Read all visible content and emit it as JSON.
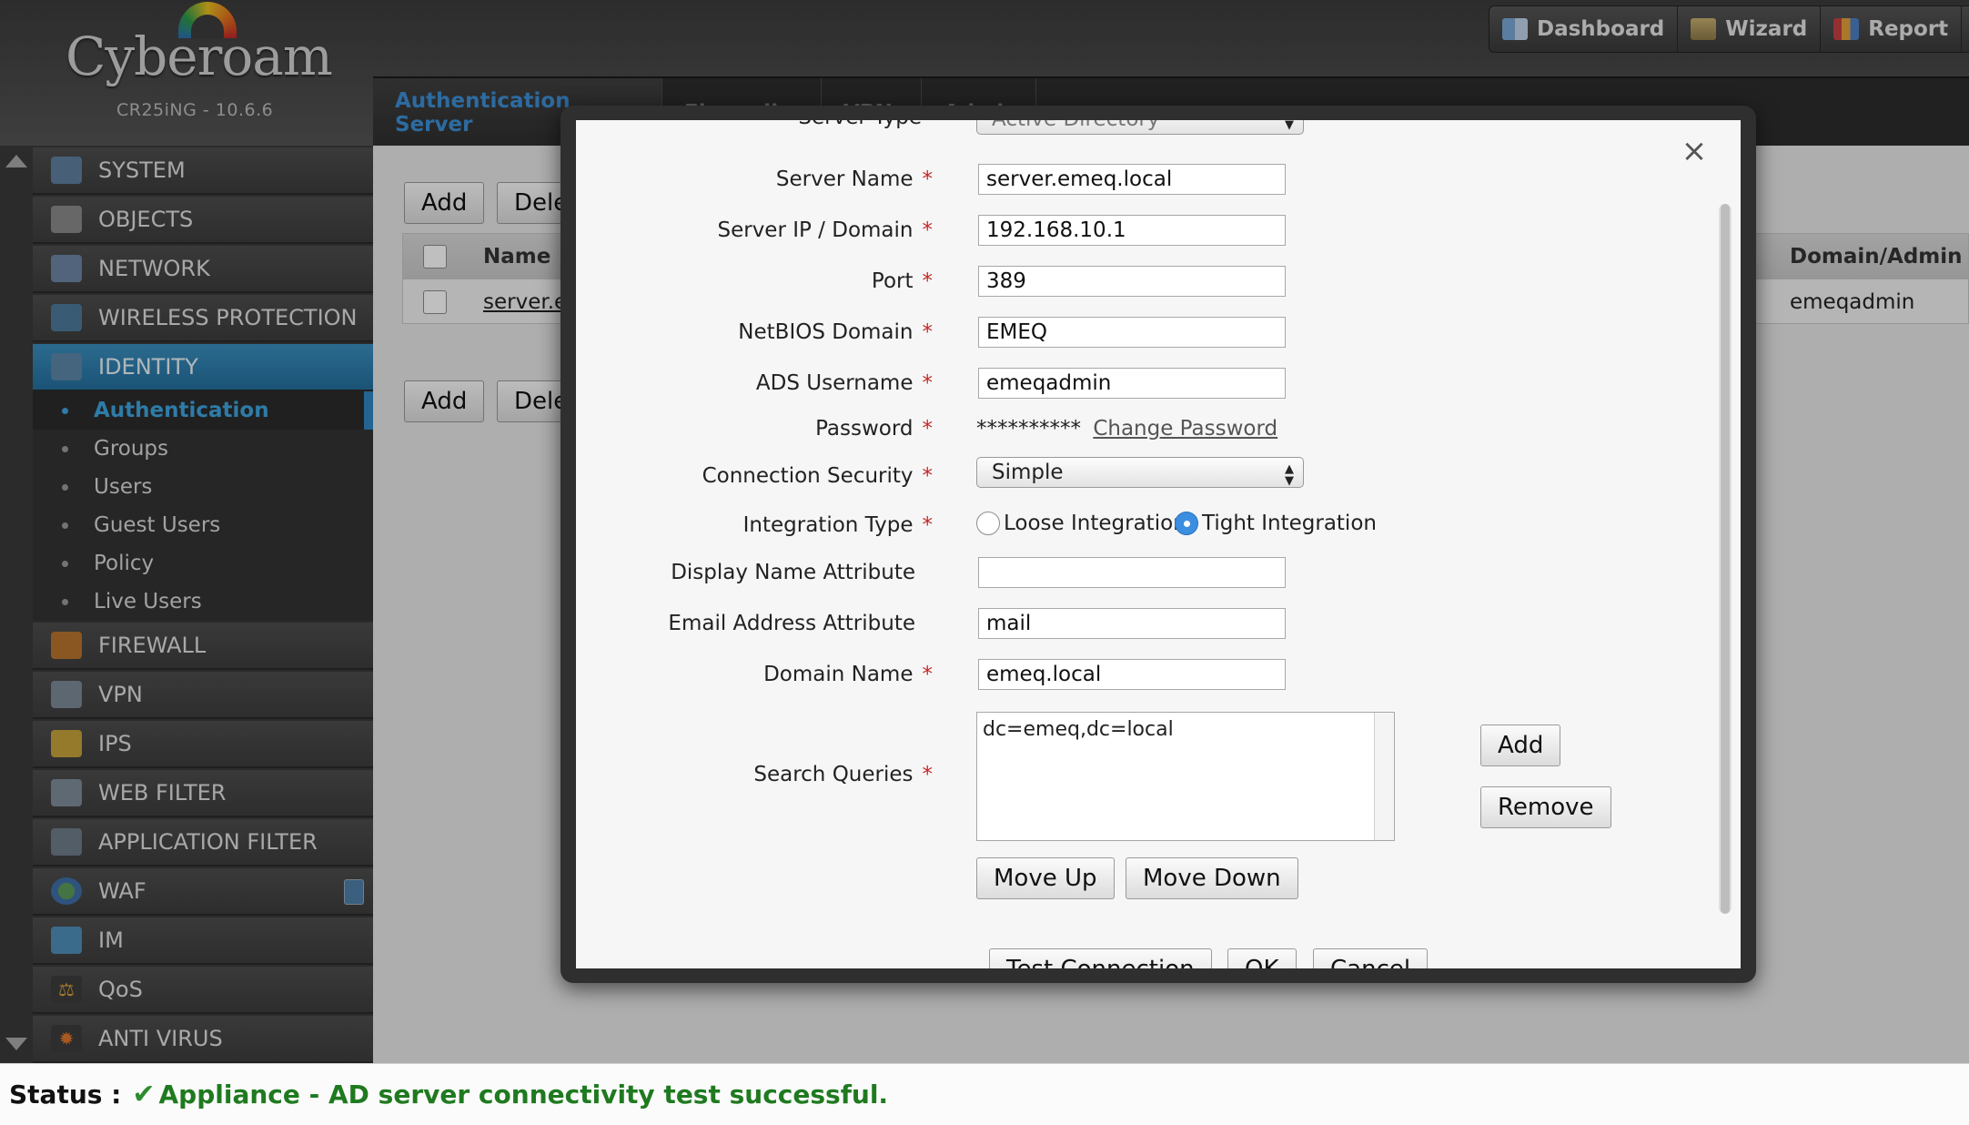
{
  "brand": {
    "name": "Cyberoam",
    "version": "CR25iNG - 10.6.6"
  },
  "topnav": [
    {
      "label": "Dashboard",
      "icon": "dashboard-icon"
    },
    {
      "label": "Wizard",
      "icon": "wizard-icon"
    },
    {
      "label": "Report",
      "icon": "report-icon"
    }
  ],
  "tabs": [
    "Authentication Server",
    "Firewall",
    "VPN",
    "Admin"
  ],
  "sidebar": {
    "items": [
      {
        "label": "SYSTEM",
        "icon": "system-icon"
      },
      {
        "label": "OBJECTS",
        "icon": "objects-icon"
      },
      {
        "label": "NETWORK",
        "icon": "network-icon"
      },
      {
        "label": "WIRELESS PROTECTION",
        "icon": "wireless-icon"
      },
      {
        "label": "IDENTITY",
        "icon": "identity-icon"
      },
      {
        "label": "FIREWALL",
        "icon": "firewall-icon"
      },
      {
        "label": "VPN",
        "icon": "vpn-icon"
      },
      {
        "label": "IPS",
        "icon": "ips-shield-icon"
      },
      {
        "label": "WEB FILTER",
        "icon": "web-filter-icon"
      },
      {
        "label": "APPLICATION FILTER",
        "icon": "application-filter-icon"
      },
      {
        "label": "WAF",
        "icon": "waf-globe-icon"
      },
      {
        "label": "IM",
        "icon": "im-icon"
      },
      {
        "label": "QoS",
        "icon": "qos-icon"
      },
      {
        "label": "ANTI VIRUS",
        "icon": "anti-virus-icon"
      }
    ],
    "submenu": [
      "Authentication",
      "Groups",
      "Users",
      "Guest Users",
      "Policy",
      "Live Users"
    ]
  },
  "content": {
    "add_label": "Add",
    "delete_label": "Delete",
    "columns": {
      "name": "Name",
      "domain_admin": "Domain/Admin"
    },
    "row": {
      "name": "server.emeq.local",
      "domain_admin": "emeqadmin"
    }
  },
  "modal": {
    "server_type_label": "Server Type",
    "server_type_value": "Active Directory",
    "fields": {
      "server_name": {
        "label": "Server Name",
        "value": "server.emeq.local"
      },
      "server_ip": {
        "label": "Server IP / Domain",
        "value": "192.168.10.1"
      },
      "port": {
        "label": "Port",
        "value": "389"
      },
      "netbios": {
        "label": "NetBIOS Domain",
        "value": "EMEQ"
      },
      "ads_username": {
        "label": "ADS Username",
        "value": "emeqadmin"
      },
      "password": {
        "label": "Password",
        "value": "**********",
        "change_link": "Change Password"
      },
      "connection_security": {
        "label": "Connection Security",
        "value": "Simple"
      },
      "integration_type": {
        "label": "Integration Type",
        "options": [
          "Loose Integration",
          "Tight Integration"
        ],
        "selected": "Tight Integration"
      },
      "display_name_attr": {
        "label": "Display Name Attribute",
        "value": ""
      },
      "email_attr": {
        "label": "Email Address Attribute",
        "value": "mail"
      },
      "domain_name": {
        "label": "Domain Name",
        "value": "emeq.local"
      },
      "search_queries": {
        "label": "Search Queries",
        "value": "dc=emeq,dc=local"
      }
    },
    "required_mark": "*",
    "buttons": {
      "add": "Add",
      "remove": "Remove",
      "move_up": "Move Up",
      "move_down": "Move Down",
      "test_connection": "Test Connection",
      "ok": "OK",
      "cancel": "Cancel"
    },
    "close": "×"
  },
  "status": {
    "label": "Status :",
    "message": "Appliance - AD server connectivity test successful.",
    "colors": {
      "success": "#1f7a1f"
    }
  },
  "colors": {
    "accent": "#2f86c2",
    "active_tab": "#3c8fd6",
    "required": "#c62828"
  }
}
